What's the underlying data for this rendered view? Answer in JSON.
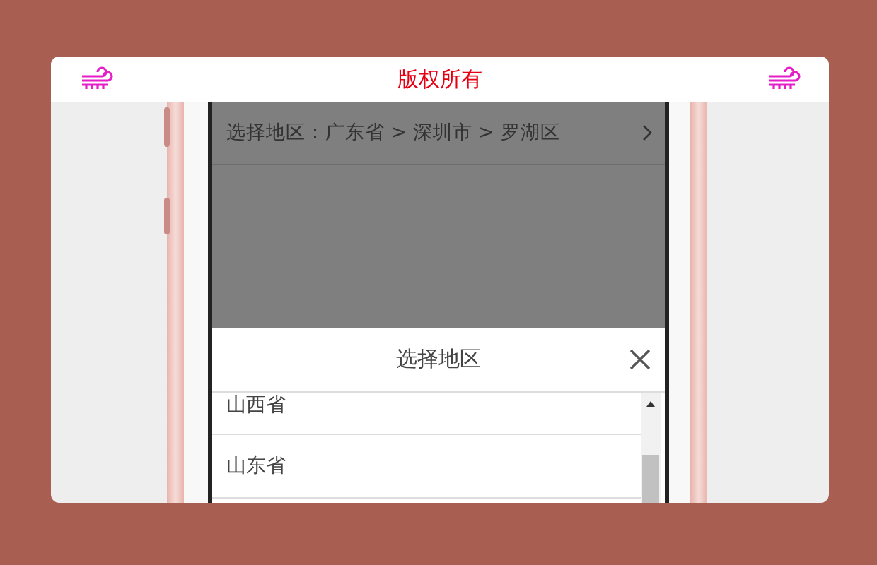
{
  "header": {
    "title": "版权所有"
  },
  "address_row": {
    "text": "选择地区：广东省 > 深圳市 > 罗湖区"
  },
  "sheet": {
    "title": "选择地区",
    "items": [
      {
        "label": "山西省"
      },
      {
        "label": "山东省"
      }
    ]
  }
}
